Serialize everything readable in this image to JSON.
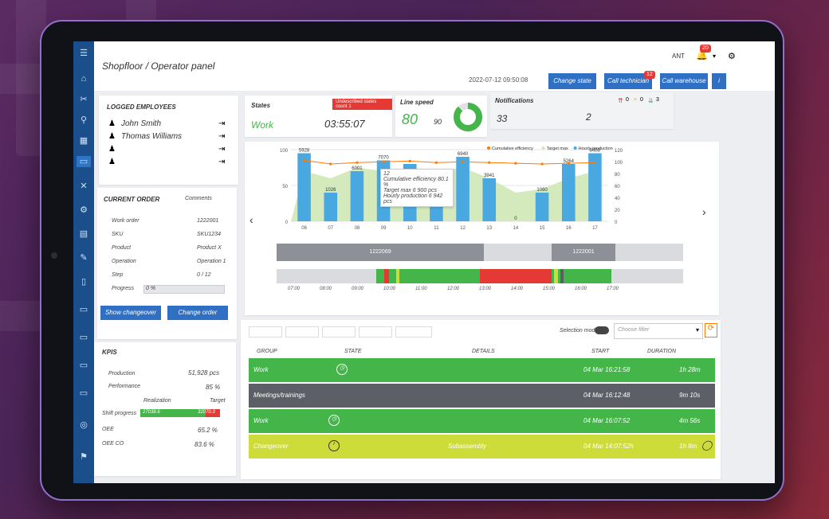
{
  "header": {
    "title": "Shopfloor / Operator panel",
    "datetime": "2022-07-12 09:50:08",
    "buttons": [
      "Change state",
      "Call technician",
      "Call warehouse"
    ],
    "technician_badge": "12",
    "user": "ANT",
    "notif_badge": "20"
  },
  "employees": {
    "title": "LOGGED EMPLOYEES",
    "names": [
      "John Smith",
      "Thomas Williams"
    ]
  },
  "states": {
    "title": "States",
    "alert": "Undescribed states count 1",
    "state_value": "Work",
    "duration": "03:55:07"
  },
  "line_speed": {
    "title": "Line speed",
    "value": "80",
    "target": "90",
    "gauge": {
      "fill_percent": 88
    }
  },
  "notifications": {
    "title": "Notifications",
    "count_left": "33",
    "count_right": "2",
    "icons": [
      "0",
      "0",
      "3"
    ]
  },
  "chart_data": {
    "type": "bar",
    "categories": [
      "06",
      "07",
      "08",
      "09",
      "10",
      "11",
      "12",
      "13",
      "14",
      "15",
      "16",
      "17"
    ],
    "series": [
      {
        "name": "Hourly production",
        "values": [
          95,
          40,
          70,
          85,
          80,
          60,
          90,
          60,
          0,
          40,
          80,
          95
        ]
      },
      {
        "name": "Target max",
        "values": [
          70,
          60,
          75,
          70,
          65,
          70,
          75,
          60,
          40,
          45,
          60,
          70
        ]
      },
      {
        "name": "Cumulative efficiency",
        "values": [
          85,
          80,
          82,
          83,
          84,
          82,
          83,
          82,
          81,
          80,
          81,
          82
        ]
      }
    ],
    "bar_labels": [
      "5928",
      "1026",
      "6001",
      "7070",
      "",
      "",
      "6940",
      "3941",
      "0",
      "1060",
      "5264",
      "8468"
    ],
    "y_left": [
      "100",
      "50",
      "0"
    ],
    "y_right": [
      "120",
      "100",
      "80",
      "60",
      "40",
      "20",
      "0"
    ],
    "tooltip": [
      "12",
      "Cumulative efficiency 80.1 %",
      "Target max 6 900 pcs",
      "Hourly production 6 942 pcs"
    ]
  },
  "timeline": {
    "orders": [
      "1222069",
      "1222001"
    ],
    "ticks": [
      "07:00",
      "08:00",
      "09:00",
      "10:00",
      "11:00",
      "12:00",
      "13:00",
      "14:00",
      "15:00",
      "16:00",
      "17:00"
    ]
  },
  "order": {
    "title": "CURRENT ORDER",
    "comments": "Comments",
    "rows": [
      {
        "label": "Work order",
        "value": "1222001"
      },
      {
        "label": "SKU",
        "value": "SKU1234"
      },
      {
        "label": "Product",
        "value": "Product X"
      },
      {
        "label": "Operation",
        "value": "Operation 1"
      },
      {
        "label": "Step",
        "value": "0 / 12"
      }
    ],
    "progress_label": "Progress",
    "progress_value": "0 %",
    "btn_changeover": "Show changeover",
    "btn_change_order": "Change order"
  },
  "kpis": {
    "title": "KPIS",
    "production_label": "Production",
    "production_value": "51,928 pcs",
    "performance_label": "Performance",
    "performance_value": "85 %",
    "realization": "Realization",
    "target": "Target",
    "shift_label": "Shift progress",
    "shift_left": "27038.6",
    "shift_right": "32070.3",
    "oee_label": "OEE",
    "oee_value": "65.2 %",
    "oeeco_label": "OEE CO",
    "oeeco_value": "83.6 %"
  },
  "table": {
    "selection_mode": "Selection mode",
    "filter_placeholder": "Choose filter",
    "columns": [
      "GROUP",
      "STATE",
      "DETAILS",
      "START",
      "DURATION"
    ],
    "rows": [
      {
        "group": "Work",
        "start": "04 Mar 16:21:58",
        "duration": "1h 28m",
        "color": "#43b549"
      },
      {
        "group": "Meetings/trainings",
        "start": "04 Mar 16:12:48",
        "duration": "9m 10s",
        "color": "#5d5f66"
      },
      {
        "group": "Work",
        "start": "04 Mar 16:07:52",
        "duration": "4m 56s",
        "color": "#43b549"
      },
      {
        "group": "Changeover",
        "start": "04 Mar 14:07:52h",
        "duration": "1h 8m",
        "color": "#cddc39",
        "details": "Subassembly"
      }
    ]
  }
}
